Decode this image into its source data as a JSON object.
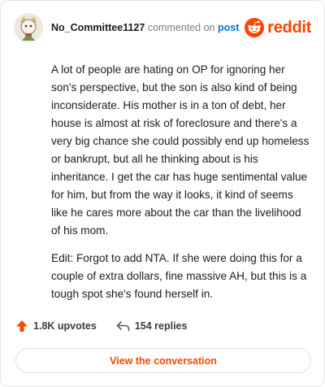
{
  "comment": {
    "author": "No_Committee1127",
    "commented_on_text": "commented on",
    "post_link_label": "post",
    "brand_name": "reddit",
    "paragraphs": [
      "A lot of people are hating on OP for ignoring her son's perspective, but the son is also kind of being inconsiderate. His mother is in a ton of debt, her house is almost at risk of foreclosure and there's a very big chance she could possibly end up homeless or bankrupt, but all he thinking about is his inheritance. I get the car has huge sentimental value for him, but from the way it looks, it kind of seems like he cares more about the car than the livelihood of his mom.",
      "Edit: Forgot to add NTA. If she were doing this for a couple of extra dollars, fine massive AH, but this is a tough spot she's found herself in."
    ]
  },
  "footer": {
    "upvotes_label": "1.8K upvotes",
    "replies_label": "154 replies",
    "cta_label": "View the conversation"
  },
  "icons": {
    "avatar": "avatar-icon",
    "brand": "reddit-snoo-icon",
    "upvote": "upvote-arrow-icon",
    "reply": "reply-arrow-icon"
  },
  "colors": {
    "brand": "#ff4500",
    "link": "#0079d3",
    "text": "#1c1c1c",
    "muted": "#7c7c7c",
    "border": "#e5e5e5"
  }
}
